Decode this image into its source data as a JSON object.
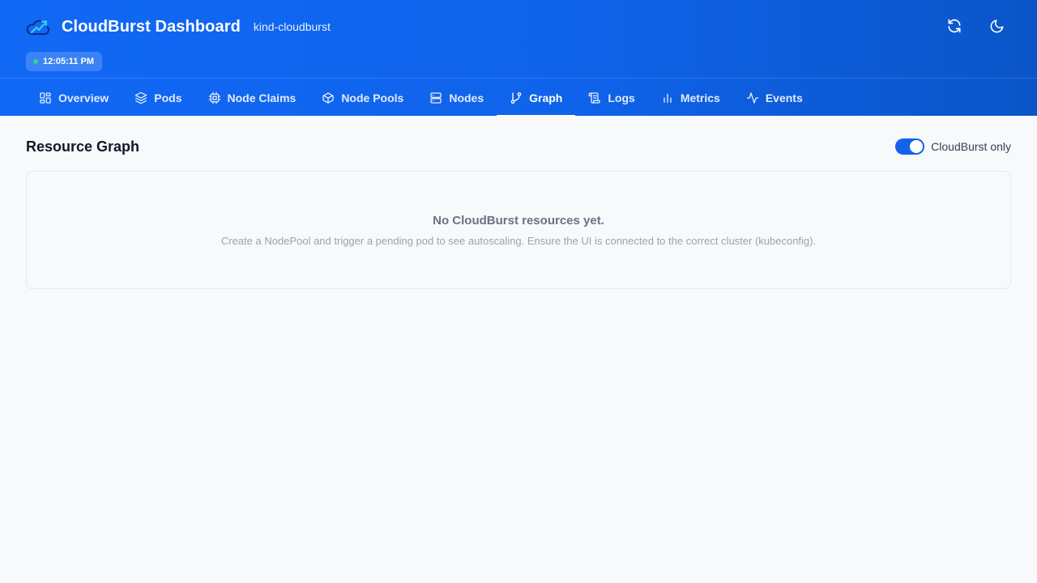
{
  "header": {
    "app_title": "CloudBurst Dashboard",
    "cluster": "kind-cloudburst",
    "time": "12:05:11 PM",
    "actions": [
      {
        "icon": "refresh-icon"
      },
      {
        "icon": "moon-icon"
      }
    ]
  },
  "nav": {
    "tabs": [
      {
        "label": "Overview",
        "icon": "grid-icon"
      },
      {
        "label": "Pods",
        "icon": "layers-icon"
      },
      {
        "label": "Node Claims",
        "icon": "chip-icon"
      },
      {
        "label": "Node Pools",
        "icon": "box-icon"
      },
      {
        "label": "Nodes",
        "icon": "server-icon"
      },
      {
        "label": "Graph",
        "icon": "git-branch-icon",
        "active": true
      },
      {
        "label": "Logs",
        "icon": "scroll-icon"
      },
      {
        "label": "Metrics",
        "icon": "bar-chart-icon"
      },
      {
        "label": "Events",
        "icon": "activity-icon"
      }
    ]
  },
  "main": {
    "title": "Resource Graph",
    "filter_label": "CloudBurst only",
    "filter_enabled": true,
    "empty_title": "No CloudBurst resources yet.",
    "empty_description": "Create a NodePool and trigger a pending pod to see autoscaling. Ensure the UI is connected to the correct cluster (kubeconfig)."
  },
  "colors": {
    "header_start": "#1168f5",
    "header_end": "#0a55c8",
    "toggle_on": "#1163ea",
    "live_dot": "#34d399",
    "background": "#f7f9fb"
  }
}
